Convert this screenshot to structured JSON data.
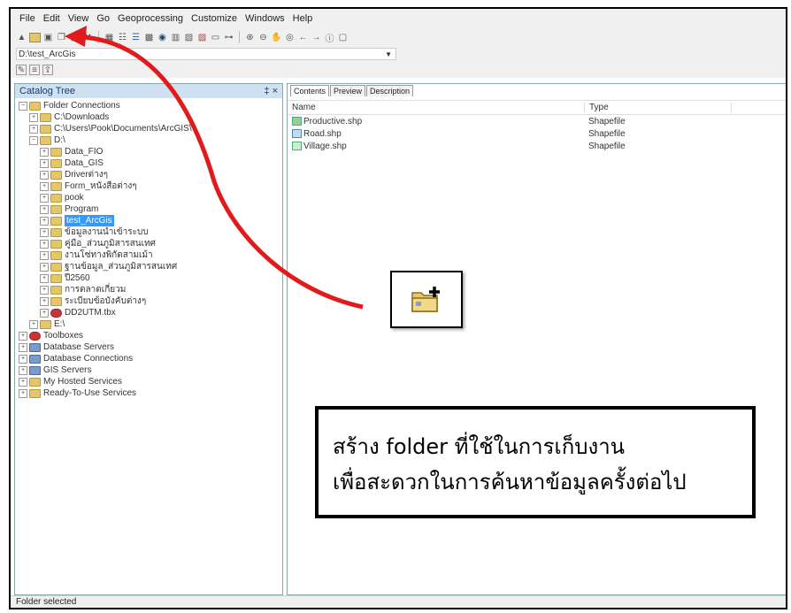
{
  "menu": [
    "File",
    "Edit",
    "View",
    "Go",
    "Geoprocessing",
    "Customize",
    "Windows",
    "Help"
  ],
  "address": {
    "value": "D:\\test_ArcGis"
  },
  "catalog": {
    "title": "Catalog Tree",
    "controls": "‡ ×",
    "tree": [
      {
        "label": "Folder Connections",
        "level": 0,
        "expander": "−",
        "icon": "folder-connections-icon"
      },
      {
        "label": "C:\\Downloads",
        "level": 1,
        "expander": "+",
        "icon": "folder-icon"
      },
      {
        "label": "C:\\Users\\Pook\\Documents\\ArcGIS\\",
        "level": 1,
        "expander": "+",
        "icon": "folder-icon"
      },
      {
        "label": "D:\\",
        "level": 1,
        "expander": "−",
        "icon": "folder-icon"
      },
      {
        "label": "Data_FIO",
        "level": 2,
        "expander": "+",
        "icon": "folder-icon"
      },
      {
        "label": "Data_GIS",
        "level": 2,
        "expander": "+",
        "icon": "folder-icon"
      },
      {
        "label": "Driverต่างๆ",
        "level": 2,
        "expander": "+",
        "icon": "folder-icon"
      },
      {
        "label": "Form_หนังสือต่างๆ",
        "level": 2,
        "expander": "+",
        "icon": "folder-icon"
      },
      {
        "label": "pook",
        "level": 2,
        "expander": "+",
        "icon": "folder-icon"
      },
      {
        "label": "Program",
        "level": 2,
        "expander": "+",
        "icon": "folder-icon"
      },
      {
        "label": "test_ArcGis",
        "level": 2,
        "expander": "+",
        "icon": "folder-icon",
        "selected": true
      },
      {
        "label": "ข้อมูลงานนำเข้าระบบ",
        "level": 2,
        "expander": "+",
        "icon": "folder-icon"
      },
      {
        "label": "คู่มือ_ส่วนภูมิสารสนเทศ",
        "level": 2,
        "expander": "+",
        "icon": "folder-icon"
      },
      {
        "label": "งานโซ่ทางพิกัดสามเม้า",
        "level": 2,
        "expander": "+",
        "icon": "folder-icon"
      },
      {
        "label": "ฐานข้อมูล_ส่วนภูมิสารสนเทศ",
        "level": 2,
        "expander": "+",
        "icon": "folder-icon"
      },
      {
        "label": "ปี2560",
        "level": 2,
        "expander": "+",
        "icon": "folder-icon"
      },
      {
        "label": "การตลาดเกี่ยวม",
        "level": 2,
        "expander": "+",
        "icon": "folder-icon"
      },
      {
        "label": "ระเบียบข้อบังคับต่างๆ",
        "level": 2,
        "expander": "+",
        "icon": "folder-icon"
      },
      {
        "label": "DD2UTM.tbx",
        "level": 2,
        "expander": "+",
        "icon": "toolbox-icon"
      },
      {
        "label": "E:\\",
        "level": 1,
        "expander": "+",
        "icon": "folder-icon"
      },
      {
        "label": "Toolboxes",
        "level": 0,
        "expander": "+",
        "icon": "toolboxes-icon"
      },
      {
        "label": "Database Servers",
        "level": 0,
        "expander": "+",
        "icon": "database-servers-icon"
      },
      {
        "label": "Database Connections",
        "level": 0,
        "expander": "+",
        "icon": "database-connections-icon"
      },
      {
        "label": "GIS Servers",
        "level": 0,
        "expander": "+",
        "icon": "gis-servers-icon"
      },
      {
        "label": "My Hosted Services",
        "level": 0,
        "expander": "+",
        "icon": "hosted-services-icon"
      },
      {
        "label": "Ready-To-Use Services",
        "level": 0,
        "expander": "+",
        "icon": "ready-services-icon"
      }
    ]
  },
  "content": {
    "tabs": [
      "Contents",
      "Preview",
      "Description"
    ],
    "columns": {
      "name": "Name",
      "type": "Type"
    },
    "rows": [
      {
        "name": "Productive.shp",
        "type": "Shapefile",
        "icon": "polygon-shapefile-icon"
      },
      {
        "name": "Road.shp",
        "type": "Shapefile",
        "icon": "line-shapefile-icon"
      },
      {
        "name": "Village.shp",
        "type": "Shapefile",
        "icon": "point-shapefile-icon"
      }
    ]
  },
  "status": "Folder selected",
  "annotation": {
    "line1": "สร้าง folder ที่ใช้ในการเก็บงาน",
    "line2": "เพื่อสะดวกในการค้นหาข้อมูลครั้งต่อไป",
    "arrow_color": "#e11b1b",
    "icon": "new-folder-connect-icon"
  }
}
